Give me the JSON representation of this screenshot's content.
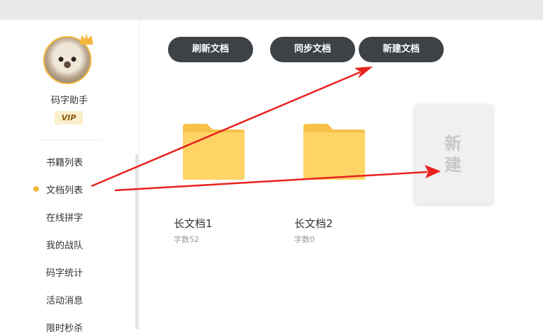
{
  "user": {
    "name": "码字助手",
    "badge": "VIP"
  },
  "sidebar": {
    "items": [
      {
        "label": "书籍列表",
        "active": false
      },
      {
        "label": "文档列表",
        "active": true
      },
      {
        "label": "在线拼字",
        "active": false
      },
      {
        "label": "我的战队",
        "active": false
      },
      {
        "label": "码字统计",
        "active": false
      },
      {
        "label": "活动消息",
        "active": false
      },
      {
        "label": "限时秒杀",
        "active": false
      }
    ]
  },
  "toolbar": {
    "refresh_label": "刷新文档",
    "sync_label": "同步文档",
    "new_label": "新建文档"
  },
  "documents": [
    {
      "title": "长文档1",
      "count": "字数52"
    },
    {
      "title": "长文档2",
      "count": "字数0"
    }
  ],
  "new_card": {
    "line1": "新",
    "line2": "建"
  },
  "colors": {
    "accent": "#f5b73b",
    "button_bg": "#3d4247",
    "annotation_arrow": "#e8231f"
  }
}
